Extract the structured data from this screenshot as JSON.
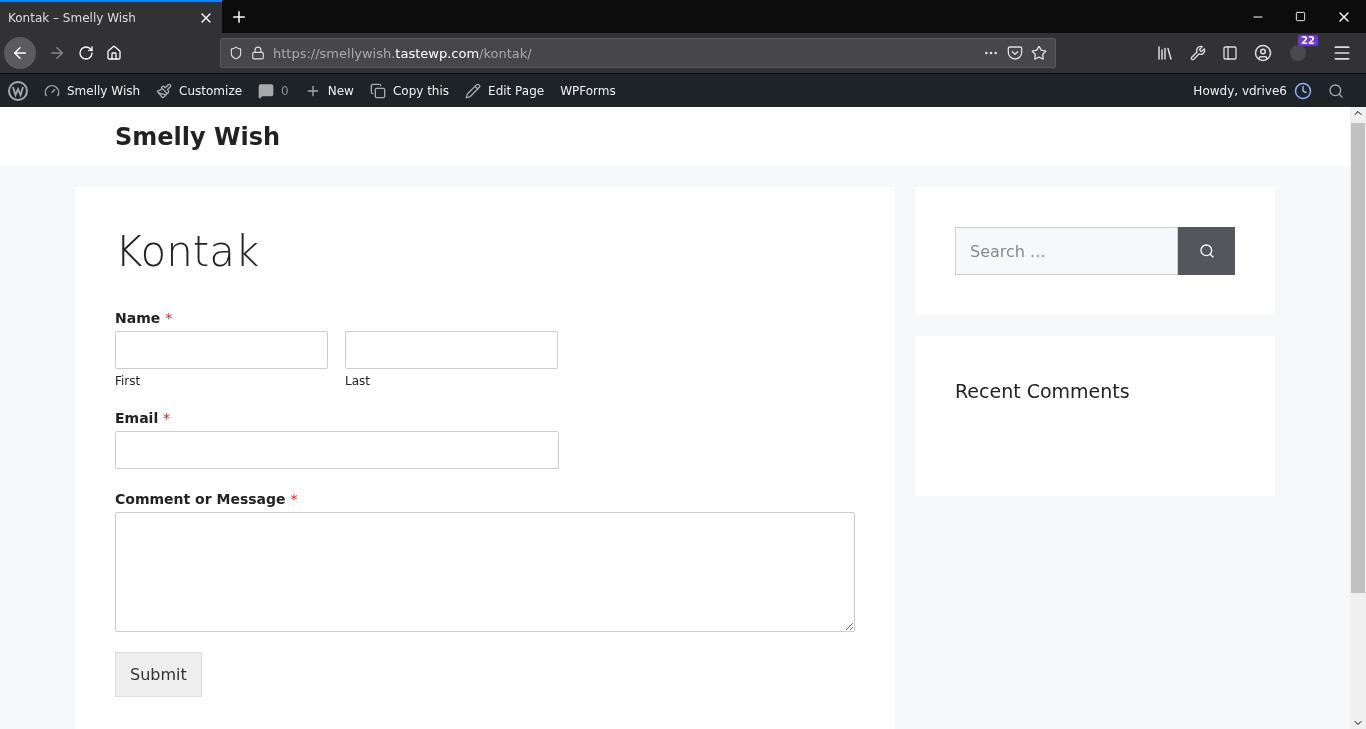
{
  "browser": {
    "tab": {
      "title": "Kontak – Smelly Wish",
      "selected": true
    },
    "url": {
      "prefix": "https://smellywish.",
      "domain": "tastewp.com",
      "path": "/kontak/"
    },
    "extension_badge": "22"
  },
  "admin_bar": {
    "items": [
      {
        "kind": "wp"
      },
      {
        "kind": "site",
        "label": "Smelly Wish"
      },
      {
        "kind": "customize",
        "label": "Customize"
      },
      {
        "kind": "comments",
        "label": "0"
      },
      {
        "kind": "new",
        "label": "New"
      },
      {
        "kind": "copy",
        "label": "Copy this"
      },
      {
        "kind": "edit",
        "label": "Edit Page"
      },
      {
        "kind": "plain",
        "label": "WPForms"
      }
    ],
    "greeting": "Howdy, vdrive6"
  },
  "site_title": "Smelly Wish",
  "page": {
    "title": "Kontak",
    "fields": [
      {
        "kind": "name",
        "label": "Name",
        "required": true,
        "sublabels": [
          "First",
          "Last"
        ]
      },
      {
        "kind": "email",
        "label": "Email",
        "required": true
      },
      {
        "kind": "textarea",
        "label": "Comment or Message",
        "required": true
      }
    ],
    "required_mark": "*",
    "submit": "Submit"
  },
  "sidebar": {
    "search_placeholder": "Search ...",
    "recent_comments_title": "Recent Comments"
  }
}
